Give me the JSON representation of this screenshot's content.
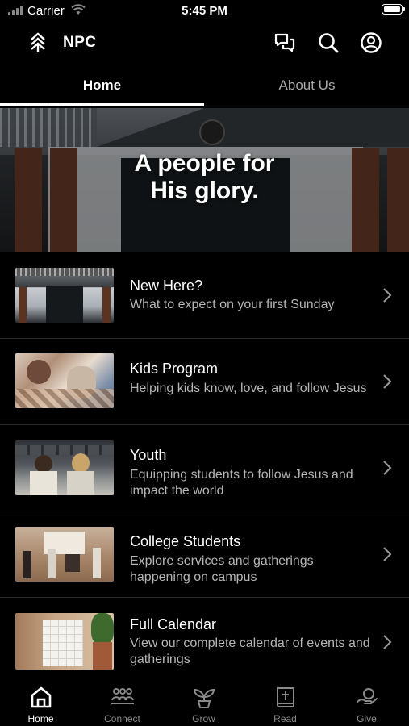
{
  "status_bar": {
    "carrier": "Carrier",
    "time": "5:45 PM"
  },
  "header": {
    "title": "NPC",
    "icons": [
      "logo-icon",
      "chat-icon",
      "search-icon",
      "account-icon"
    ]
  },
  "tabs": [
    {
      "label": "Home",
      "active": true
    },
    {
      "label": "About Us",
      "active": false
    }
  ],
  "hero": {
    "title_line1": "A people for",
    "title_line2": "His glory."
  },
  "items": [
    {
      "title": "New Here?",
      "subtitle": "What to expect on your first Sunday"
    },
    {
      "title": "Kids Program",
      "subtitle": "Helping kids know, love, and follow Jesus"
    },
    {
      "title": "Youth",
      "subtitle": "Equipping students to follow Jesus and impact the world"
    },
    {
      "title": "College Students",
      "subtitle": "Explore services and gatherings happening on campus"
    },
    {
      "title": "Full Calendar",
      "subtitle": "View our complete calendar of events and gatherings"
    }
  ],
  "tabbar": [
    {
      "label": "Home",
      "icon": "home-icon",
      "active": true
    },
    {
      "label": "Connect",
      "icon": "people-icon",
      "active": false
    },
    {
      "label": "Grow",
      "icon": "sprout-icon",
      "active": false
    },
    {
      "label": "Read",
      "icon": "bible-icon",
      "active": false
    },
    {
      "label": "Give",
      "icon": "give-icon",
      "active": false
    }
  ],
  "colors": {
    "background": "#000000",
    "text": "#ffffff",
    "muted": "#b5b5b5",
    "inactive_tab": "#8a8a8a"
  }
}
